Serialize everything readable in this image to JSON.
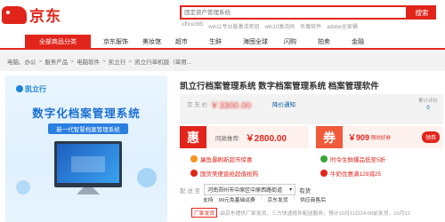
{
  "header": {
    "logo_text": "京东",
    "search_placeholder": "固定资产管理系统",
    "search_button": "搜索",
    "hot_words": [
      "office365",
      "win11专业版激活密钥",
      "win10激活码",
      "杀毒软件",
      "adobe全家桶"
    ]
  },
  "nav": {
    "category_label": "全部商品分类",
    "items": [
      "京东服饰",
      "美妆馆",
      "超市",
      "生鲜",
      "海囤全球",
      "闪购",
      "拍卖",
      "金融"
    ]
  },
  "breadcrumb": [
    "电脑、办公",
    "服务产品",
    "电脑软件",
    "凯立行",
    "凯立行单机版（单用..."
  ],
  "product_image": {
    "logo": "凯立行",
    "title": "数字化档案管理系统",
    "subtitle": "新一代智慧档案管理系统"
  },
  "product": {
    "title": "凯立行档案管理系统 数字档案管理系统 档案管理软件",
    "price_label": "京 东 价",
    "price_value": "￥3300.00",
    "notify_link": "降价通知",
    "review_label": "累计评价",
    "review_count": "0"
  },
  "coupon_left": {
    "tag": "惠",
    "label": "同款推荐:",
    "price": "￥2800.00"
  },
  "coupon_right": {
    "tag": "券",
    "amount": "￥909",
    "note": "限时好券",
    "button": "领券"
  },
  "promos": [
    {
      "text": "屠鱼暴刷新超市惊喜",
      "color": "#f7931e"
    },
    {
      "text": "时令生鲜爆品低至5折",
      "color": "#3aa53a"
    },
    {
      "text": "国货美便直抢超值抢购",
      "color": "#e1251b"
    },
    {
      "text": "牛奶优惠满129减25",
      "color": "#e1251b"
    }
  ],
  "shipping": {
    "label": "配 送 至",
    "location": "河南郑州市中原区中原西路街道",
    "stock": "有货"
  },
  "services": [
    "支持",
    "99元免基础运费",
    "京东发货",
    "供应商售后"
  ],
  "notice": {
    "tag": "厂家发货",
    "text": "由京东提供厂家发货，三方快递揽件配送服务，预计10月11日24:00前发货，10月12"
  }
}
